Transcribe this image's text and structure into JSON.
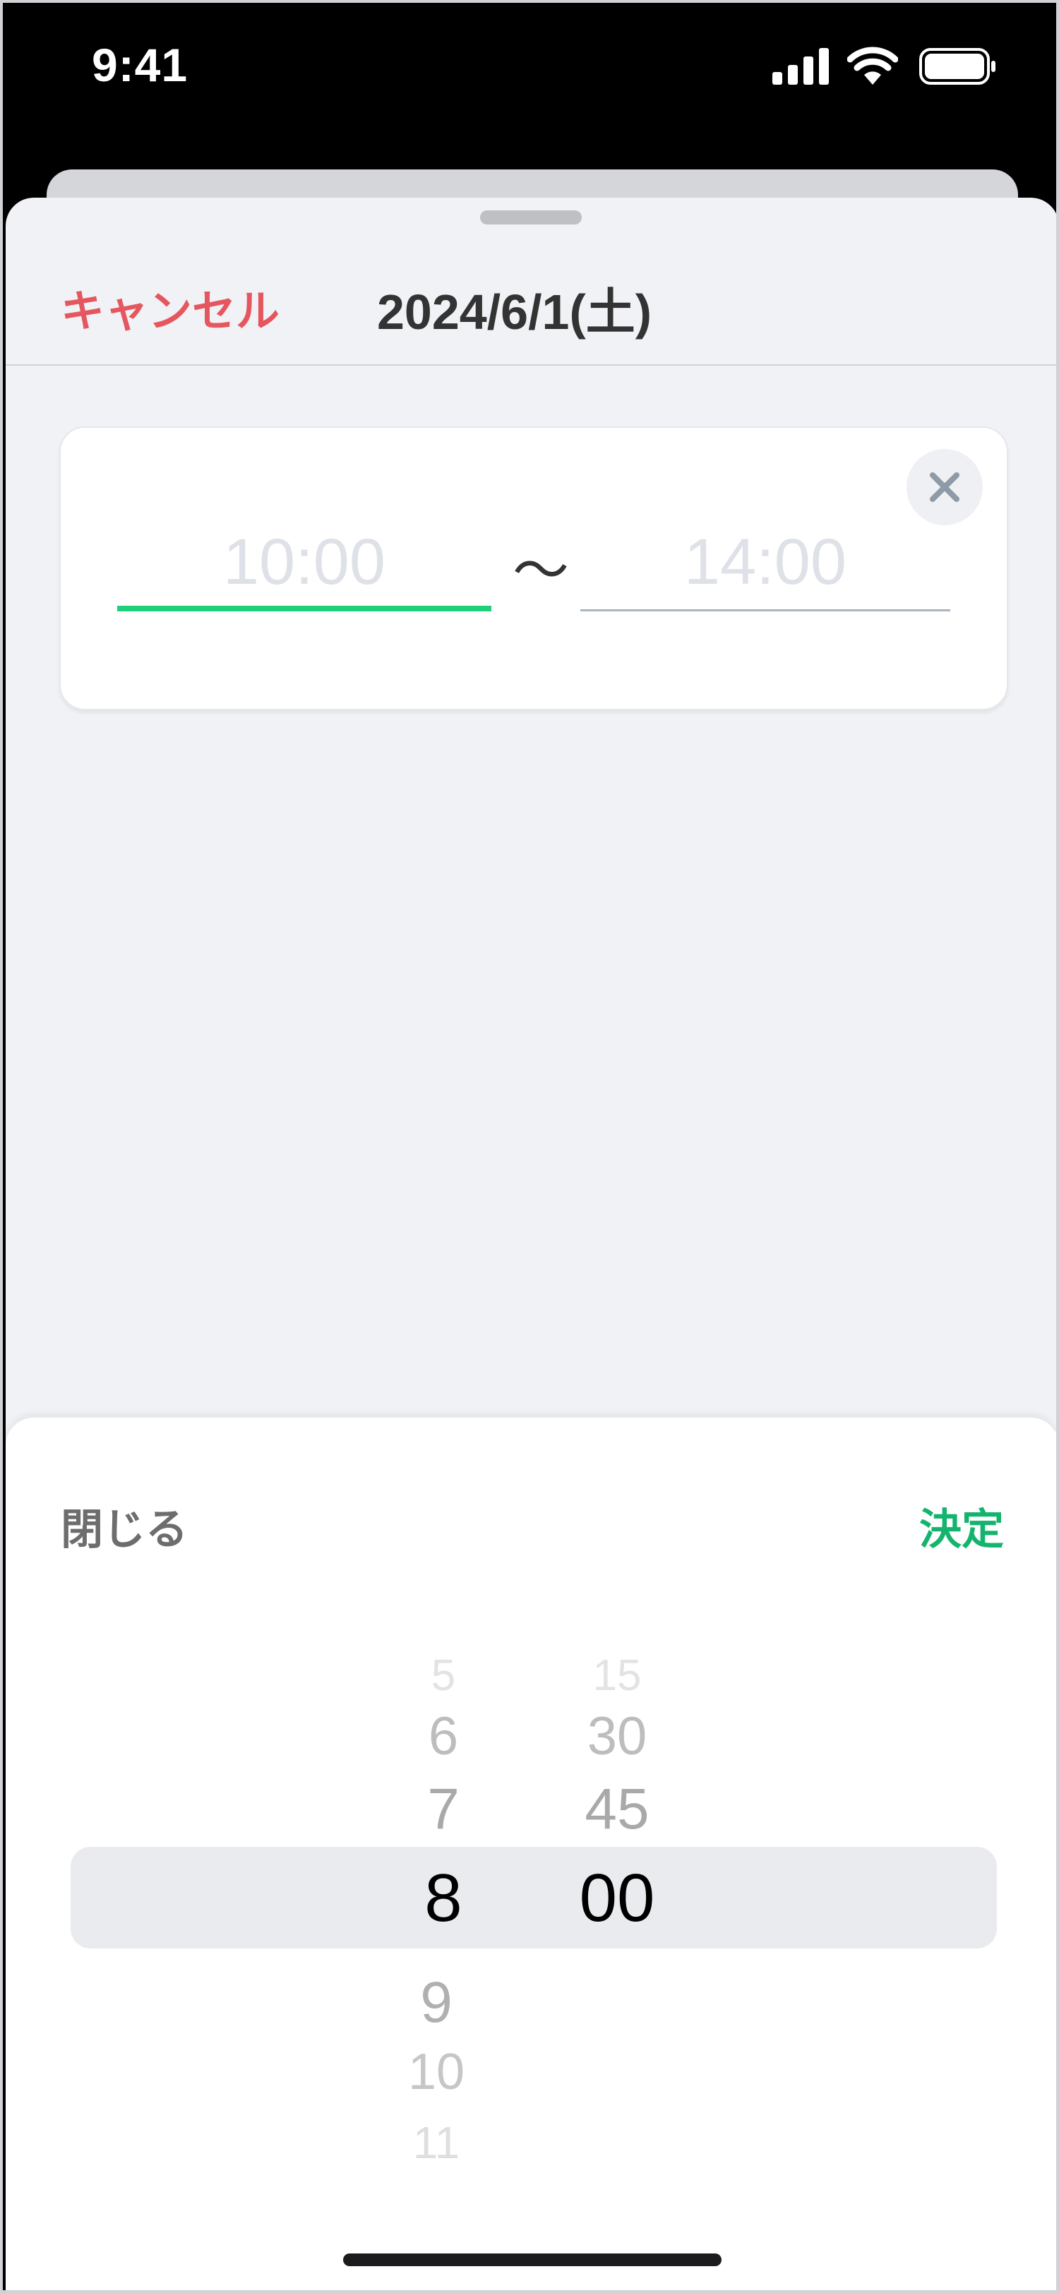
{
  "status_bar": {
    "time": "9:41"
  },
  "header": {
    "cancel_label": "キャンセル",
    "date": "2024/6/1(土)"
  },
  "time_range": {
    "start": "10:00",
    "separator": "〜",
    "end": "14:00"
  },
  "picker": {
    "close_label": "閉じる",
    "confirm_label": "決定",
    "hours": [
      "5",
      "6",
      "7",
      "8",
      "9",
      "10",
      "11"
    ],
    "minutes": [
      "15",
      "30",
      "45",
      "00"
    ],
    "selected_hour": "8",
    "selected_minute": "00"
  },
  "colors": {
    "accent_green": "#1ed07a",
    "confirm_green": "#14b46e",
    "cancel_red": "#e5575f"
  }
}
